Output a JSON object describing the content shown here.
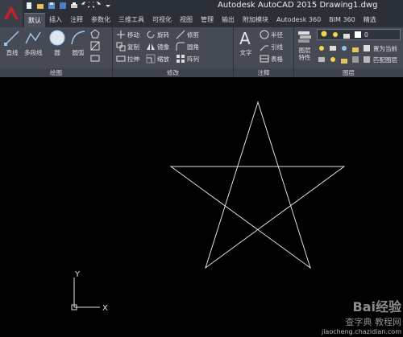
{
  "window": {
    "title": "Autodesk AutoCAD 2015    Drawing1.dwg"
  },
  "ribbon_tabs": [
    {
      "label": "默认",
      "active": true
    },
    {
      "label": "插入"
    },
    {
      "label": "注释"
    },
    {
      "label": "参数化"
    },
    {
      "label": "三维工具"
    },
    {
      "label": "可视化"
    },
    {
      "label": "视图"
    },
    {
      "label": "管理"
    },
    {
      "label": "输出"
    },
    {
      "label": "附加模块"
    },
    {
      "label": "Autodesk 360"
    },
    {
      "label": "BIM 360"
    },
    {
      "label": "精选"
    }
  ],
  "panels": {
    "draw": {
      "label": "绘图",
      "line": "直线",
      "polyline": "多段线",
      "circle": "圆",
      "arc": "圆弧"
    },
    "modify": {
      "label": "修改",
      "move": "移动",
      "rotate": "旋转",
      "trim": "修剪",
      "copy": "复制",
      "mirror": "镜像",
      "fillet": "圆角",
      "stretch": "拉伸",
      "scale": "缩放",
      "array": "阵列"
    },
    "annotation": {
      "label": "注释",
      "text": "文字",
      "dimension": "半径",
      "leader": "引线",
      "table": "表格"
    },
    "layers": {
      "label": "图层",
      "properties": "图层\n特性",
      "current_layer": "0",
      "set_current": "置为当前",
      "match": "匹配图层"
    }
  },
  "ucs": {
    "x_label": "X",
    "y_label": "Y"
  },
  "watermark": {
    "brand": "Bai经验",
    "overlay": "查字典 教程网",
    "url": "jiaocheng.chazidian.com"
  },
  "colors": {
    "background": "#000000",
    "ribbon": "#454a55",
    "titlebar": "#2b2f38",
    "logo_red": "#c8202a",
    "star_stroke": "#e0e0e0"
  }
}
